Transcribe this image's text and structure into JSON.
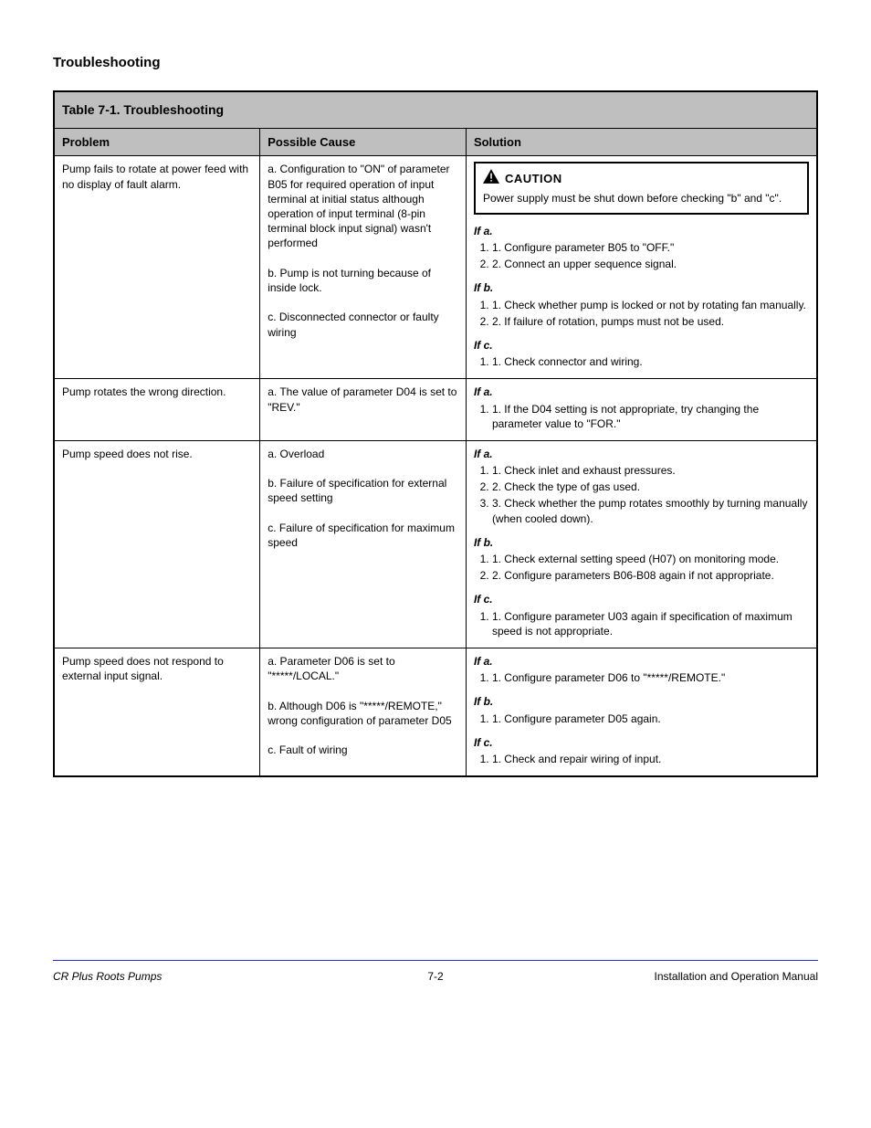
{
  "page_heading": "Troubleshooting",
  "table": {
    "title": "Table 7-1. Troubleshooting",
    "headers": {
      "problem": "Problem",
      "cause": "Possible Cause",
      "solution": "Solution"
    },
    "rows": [
      {
        "problem": "Pump fails to rotate at power feed with no display of fault alarm.",
        "causes": [
          "a. Configuration to \"ON\" of parameter B05 for required operation of input terminal at initial status although operation of input terminal (8-pin terminal block input signal) wasn't performed",
          "b. Pump is not turning because of inside lock.",
          "c. Disconnected connector or faulty wiring"
        ],
        "caution": "Power supply must be shut down before checking \"b\" and \"c\".",
        "solutions": [
          {
            "label": "If a.",
            "items": [
              "1. Configure parameter B05 to \"OFF.\"",
              "2. Connect an upper sequence signal."
            ]
          },
          {
            "label": "If b.",
            "items": [
              "1. Check whether pump is locked or not by rotating fan manually.",
              "2. If failure of rotation, pumps must not be used."
            ]
          },
          {
            "label": "If c.",
            "items": [
              "1. Check connector and wiring."
            ]
          }
        ]
      },
      {
        "problem": "Pump rotates the wrong direction.",
        "causes": [
          "a. The value of parameter D04 is set to \"REV.\""
        ],
        "solutions": [
          {
            "label": "If a.",
            "items": [
              "1. If the D04 setting is not appropriate, try changing the parameter value to \"FOR.\""
            ]
          }
        ]
      },
      {
        "problem": "Pump speed does not rise.",
        "causes": [
          "a. Overload",
          "b. Failure of specification for external speed setting",
          "c. Failure of specification for maximum speed"
        ],
        "solutions": [
          {
            "label": "If a.",
            "items": [
              "1. Check inlet and exhaust pressures.",
              "2. Check the type of gas used.",
              "3. Check whether the pump rotates smoothly by turning manually (when cooled down)."
            ]
          },
          {
            "label": "If b.",
            "items": [
              "1. Check external setting speed (H07) on monitoring mode.",
              "2. Configure parameters B06-B08 again if not appropriate."
            ]
          },
          {
            "label": "If c.",
            "items": [
              "1. Configure parameter U03 again if specification of maximum speed is not appropriate."
            ]
          }
        ]
      },
      {
        "problem": "Pump speed does not respond to external input signal.",
        "causes": [
          "a. Parameter D06 is set to \"*****/LOCAL.\"",
          "b. Although D06 is \"*****/REMOTE,\" wrong configuration of parameter D05",
          "c. Fault of wiring"
        ],
        "solutions": [
          {
            "label": "If a.",
            "items": [
              "1. Configure parameter D06 to \"*****/REMOTE.\""
            ]
          },
          {
            "label": "If b.",
            "items": [
              "1. Configure parameter D05 again."
            ]
          },
          {
            "label": "If c.",
            "items": [
              "1. Check and repair wiring of input."
            ]
          }
        ]
      }
    ]
  },
  "footer": {
    "left": "CR Plus Roots Pumps",
    "mid": "7-2",
    "right": "Installation and Operation Manual"
  }
}
